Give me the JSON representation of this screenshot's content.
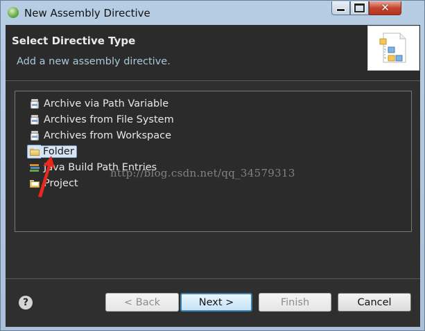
{
  "window": {
    "title": "New Assembly Directive",
    "controls": [
      "minimize",
      "maximize",
      "close"
    ]
  },
  "header": {
    "title": "Select Directive Type",
    "description": "Add a new assembly directive."
  },
  "tree": {
    "items": [
      {
        "label": "Archive via Path Variable",
        "icon": "jar-icon"
      },
      {
        "label": "Archives from File System",
        "icon": "jar-icon"
      },
      {
        "label": "Archives from Workspace",
        "icon": "jar-icon"
      },
      {
        "label": "Folder",
        "icon": "folder-icon",
        "selected": true
      },
      {
        "label": "Java Build Path Entries",
        "icon": "library-icon"
      },
      {
        "label": "Project",
        "icon": "project-icon"
      }
    ]
  },
  "watermark": "http://blog.csdn.net/qq_34579313",
  "buttons": {
    "help": "?",
    "back": "< Back",
    "next": "Next >",
    "finish": "Finish",
    "cancel": "Cancel"
  },
  "colors": {
    "accent": "#3c7fb1",
    "selection": "#d6e4f3",
    "annotation_arrow": "#e8281c"
  }
}
